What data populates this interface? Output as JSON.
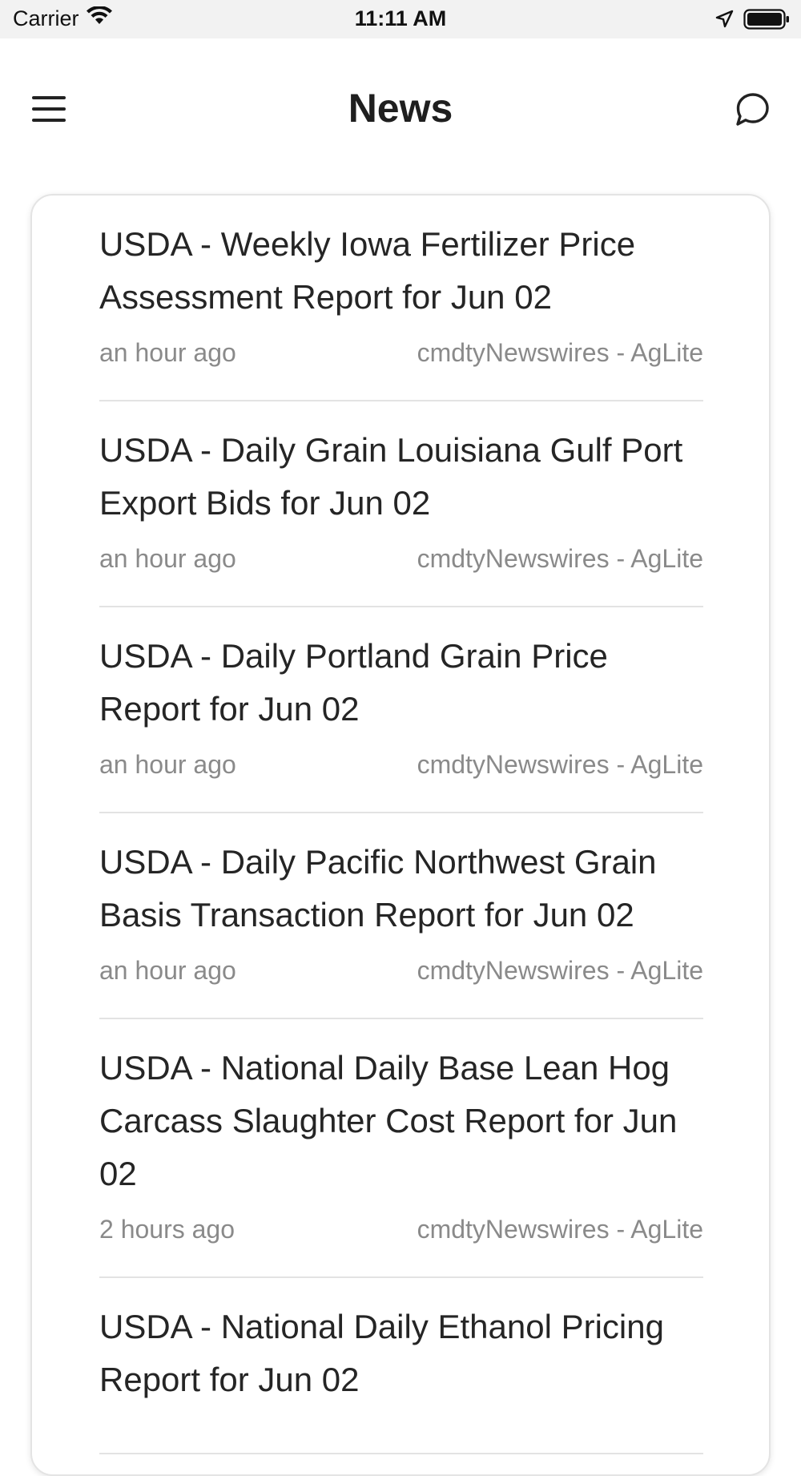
{
  "status_bar": {
    "carrier": "Carrier",
    "time": "11:11 AM"
  },
  "header": {
    "title": "News"
  },
  "news": [
    {
      "title": "USDA - Weekly Iowa Fertilizer Price Assessment Report for Jun 02",
      "time": "an hour ago",
      "source": "cmdtyNewswires - AgLite"
    },
    {
      "title": "USDA - Daily Grain Louisiana Gulf Port Export Bids for Jun 02",
      "time": "an hour ago",
      "source": "cmdtyNewswires - AgLite"
    },
    {
      "title": "USDA - Daily Portland Grain Price Report for Jun 02",
      "time": "an hour ago",
      "source": "cmdtyNewswires - AgLite"
    },
    {
      "title": "USDA - Daily Pacific Northwest Grain Basis Transaction Report for Jun 02",
      "time": "an hour ago",
      "source": "cmdtyNewswires - AgLite"
    },
    {
      "title": "USDA - National Daily Base Lean Hog Carcass Slaughter Cost Report for Jun 02",
      "time": "2 hours ago",
      "source": "cmdtyNewswires - AgLite"
    },
    {
      "title": "USDA - National Daily Ethanol Pricing Report for Jun 02",
      "time": "",
      "source": ""
    }
  ],
  "icons": {
    "wifi": "wifi-icon",
    "location": "location-arrow-icon",
    "battery": "battery-icon",
    "menu": "hamburger-menu-icon",
    "chat": "chat-bubble-icon"
  }
}
